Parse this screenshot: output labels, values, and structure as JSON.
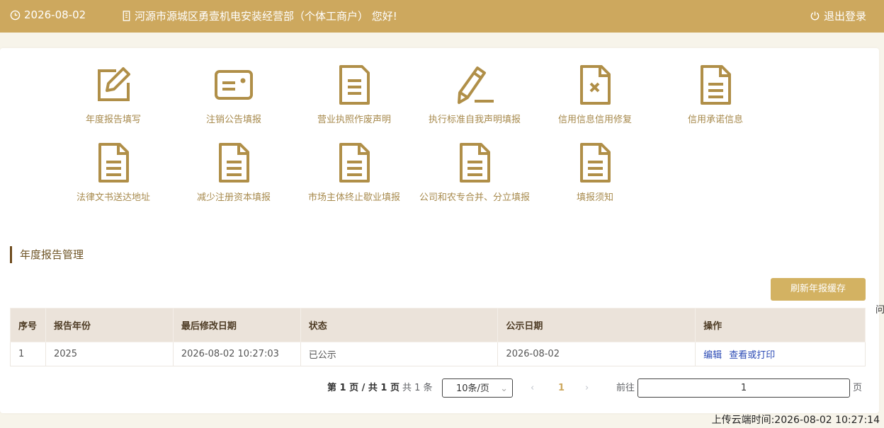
{
  "header": {
    "date": "2026-08-02",
    "greeting": "河源市源城区勇壹机电安装经营部（个体工商户） 您好!",
    "logout": "退出登录"
  },
  "menu": [
    {
      "label": "年度报告填写",
      "icon": "edit-icon"
    },
    {
      "label": "注销公告填报",
      "icon": "id-card-icon"
    },
    {
      "label": "营业执照作废声明",
      "icon": "document-icon"
    },
    {
      "label": "执行标准自我声明填报",
      "icon": "pencil-icon"
    },
    {
      "label": "信用信息信用修复",
      "icon": "document-x-icon"
    },
    {
      "label": "信用承诺信息",
      "icon": "document-icon"
    },
    {
      "label": "法律文书送达地址",
      "icon": "document-icon"
    },
    {
      "label": "减少注册资本填报",
      "icon": "document-icon"
    },
    {
      "label": "市场主体终止歇业填报",
      "icon": "document-icon"
    },
    {
      "label": "公司和农专合并、分立填报",
      "icon": "document-icon"
    },
    {
      "label": "填报须知",
      "icon": "document-icon"
    }
  ],
  "section": {
    "title": "年度报告管理",
    "refresh": "刷新年报缓存",
    "edge_char": "问"
  },
  "table": {
    "columns": [
      "序号",
      "报告年份",
      "最后修改日期",
      "状态",
      "公示日期",
      "操作"
    ],
    "rows": [
      {
        "index": "1",
        "year": "2025",
        "modified": "2026-08-02 10:27:03",
        "status": "已公示",
        "publish_date": "2026-08-02",
        "actions": [
          "编辑",
          "查看或打印"
        ]
      }
    ]
  },
  "pagination": {
    "page_info": "第 1 页 / 共 1 页",
    "total": "共 1 条",
    "page_size": "10条/页",
    "current": "1",
    "goto": "前往",
    "goto_value": "1",
    "page_unit": "页"
  },
  "footer": {
    "upload_time": "上传云端时间:2026-08-02 10:27:14"
  },
  "colors": {
    "accent": "#cda85e",
    "icon": "#b08f48",
    "label": "#a78a4d",
    "link": "#2c4bb5"
  }
}
